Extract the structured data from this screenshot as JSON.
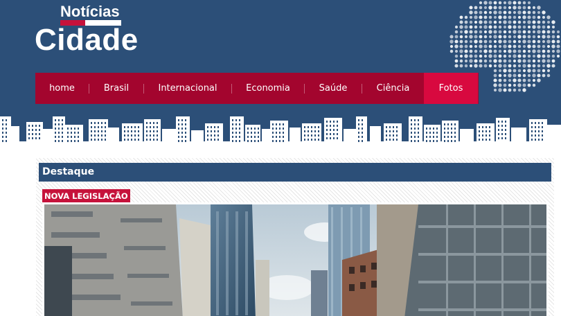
{
  "site": {
    "logo_top": "Notícias",
    "logo_main": "Cidade"
  },
  "nav": {
    "items": [
      {
        "label": "home"
      },
      {
        "label": "Brasil"
      },
      {
        "label": "Internacional"
      },
      {
        "label": "Economia"
      },
      {
        "label": "Saúde"
      },
      {
        "label": "Ciência"
      },
      {
        "label": "Fotos"
      }
    ],
    "active_index": 6
  },
  "featured": {
    "section_title": "Destaque",
    "tag": "NOVA LEGISLAÇÃO"
  },
  "colors": {
    "header_bg": "#2c4f78",
    "nav_bg": "#a3052e",
    "nav_active": "#d8093f",
    "tag_bg": "#c6123b"
  }
}
